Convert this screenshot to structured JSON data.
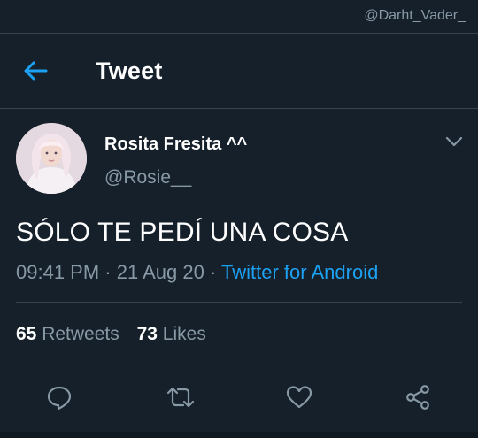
{
  "watermark": "@Darht_Vader_",
  "header": {
    "title": "Tweet"
  },
  "tweet": {
    "author_name": "Rosita Fresita ^^",
    "author_handle": "@Rosie__",
    "text": "SÓLO TE PEDÍ UNA COSA",
    "time": "09:41 PM",
    "date": "21 Aug 20",
    "source": "Twitter for Android"
  },
  "stats": {
    "retweets_count": "65",
    "retweets_label": "Retweets",
    "likes_count": "73",
    "likes_label": "Likes"
  },
  "icons": {
    "back": "back-arrow-icon",
    "more": "chevron-down-icon",
    "reply": "reply-icon",
    "retweet": "retweet-icon",
    "like": "heart-icon",
    "share": "share-icon"
  },
  "colors": {
    "background": "#15202b",
    "accent": "#1da1f2",
    "secondary_text": "#8899a6",
    "divider": "#38444d"
  }
}
